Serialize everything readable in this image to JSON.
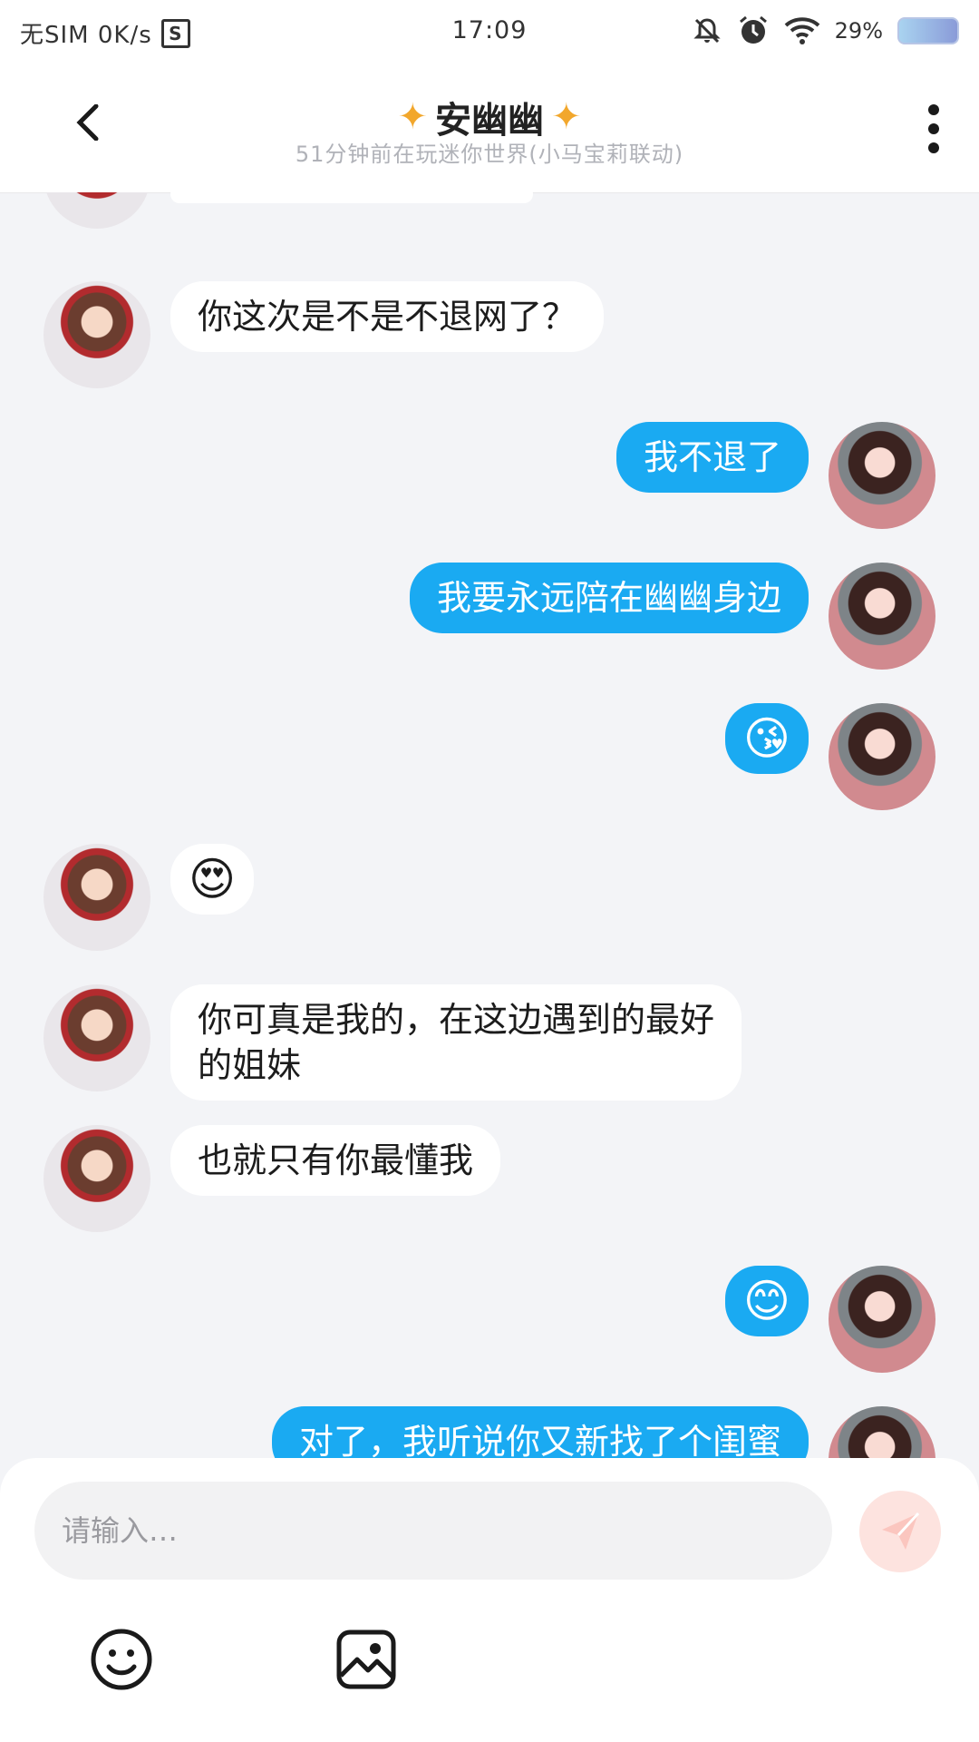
{
  "status": {
    "carrier": "无SIM 0K/s",
    "time": "17:09",
    "battery": "29%"
  },
  "header": {
    "title": "安幽幽",
    "subtitle": "51分钟前在玩迷你世界(小马宝莉联动)"
  },
  "messages": [
    {
      "side": "left",
      "text": "你这次是不是不退网了？"
    },
    {
      "side": "right",
      "text": "我不退了"
    },
    {
      "side": "right",
      "text": "我要永远陪在幽幽身边"
    },
    {
      "side": "right",
      "text": "😘"
    },
    {
      "side": "left",
      "text": "😍"
    },
    {
      "side": "left",
      "text": "你可真是我的，在这边遇到的最好"
    },
    {
      "side": "left",
      "text": "的姐妹"
    },
    {
      "side": "left",
      "text": "也就只有你最懂我"
    },
    {
      "side": "right",
      "text": "😊"
    },
    {
      "side": "right",
      "text": "对了，我听说你又新找了个闺蜜"
    }
  ],
  "composer": {
    "placeholder": "请输入…",
    "emoji_icon": "smile-icon",
    "image_icon": "image-icon",
    "send_icon": "send-icon"
  },
  "colors": {
    "accent": "#1aaaf2",
    "bubble_in": "#ffffff",
    "background": "#f3f4f7"
  }
}
